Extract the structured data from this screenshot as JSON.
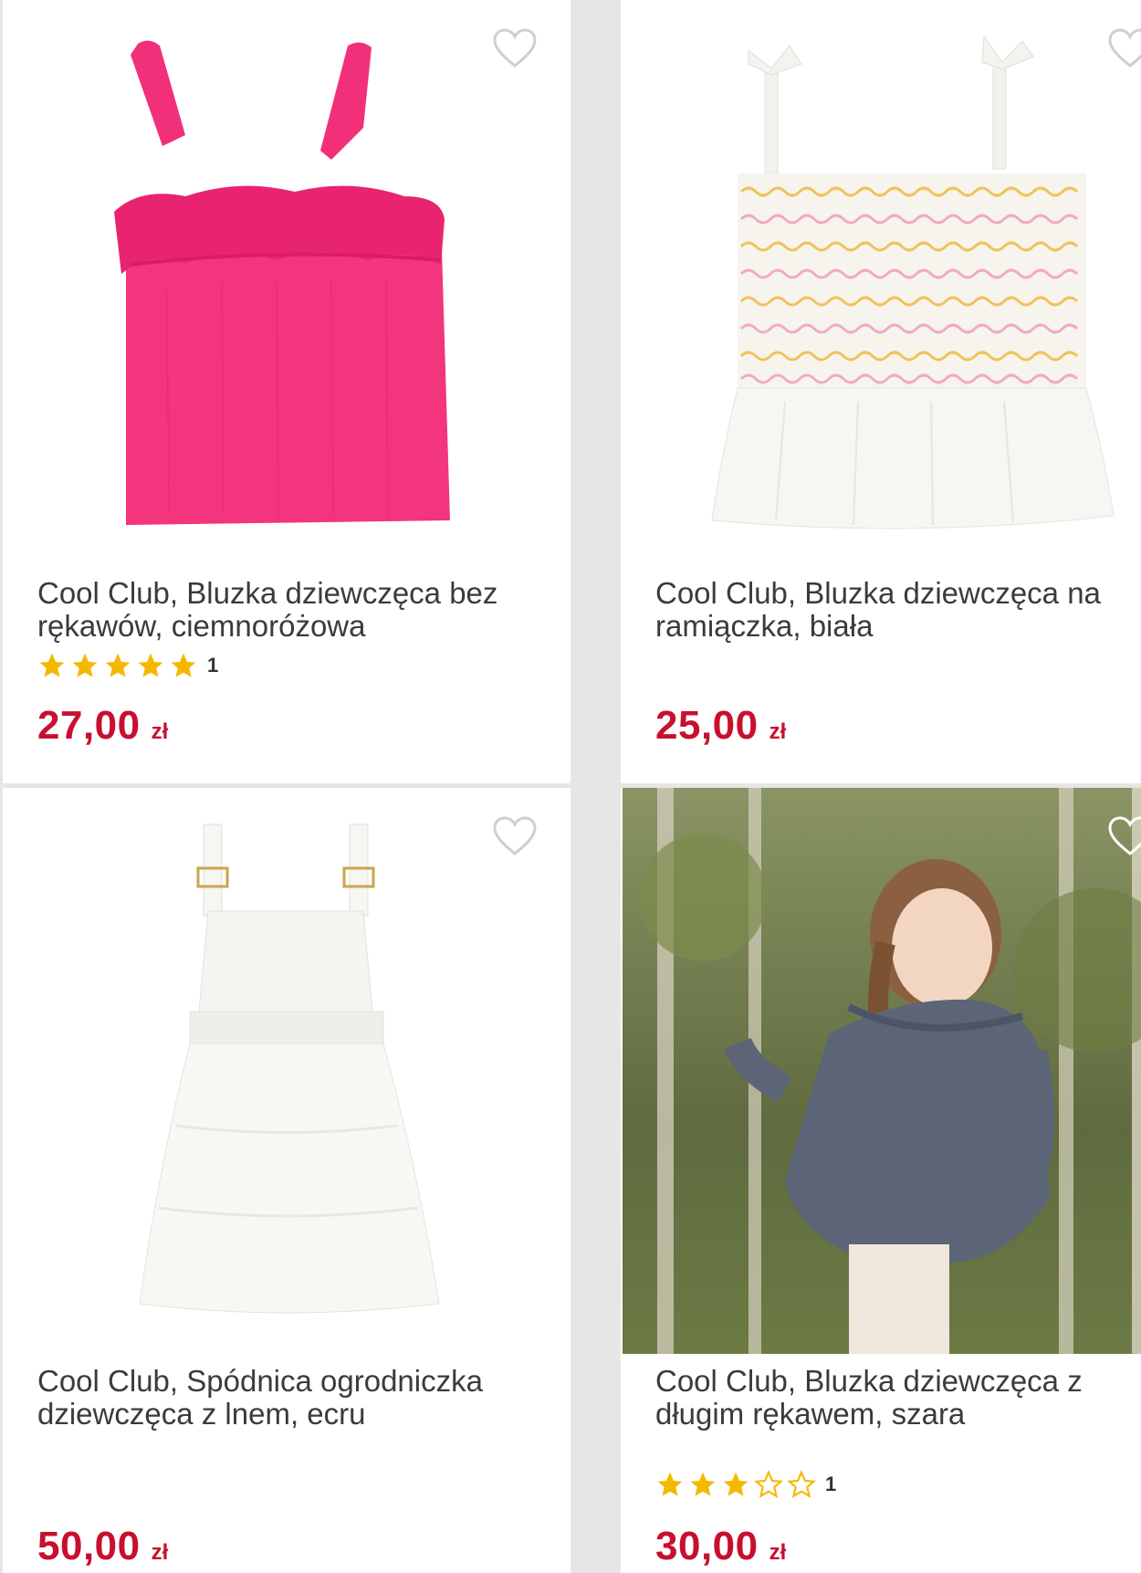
{
  "products": [
    {
      "title": "Cool Club, Bluzka dziewczęca bez rękawów, ciemnoróżowa",
      "rating": 5,
      "rating_count": "1",
      "price": "27,00",
      "currency": "zł",
      "image": "pink-ruffled-top"
    },
    {
      "title": "Cool Club, Bluzka dziewczęca na ramiączka, biała",
      "price": "25,00",
      "currency": "zł",
      "image": "white-smocked-top"
    },
    {
      "title": "Cool Club, Spódnica ogrodniczka dziewczęca z lnem, ecru",
      "price": "50,00",
      "currency": "zł",
      "image": "white-pinafore-dress"
    },
    {
      "title": "Cool Club, Bluzka dziewczęca z długim rękawem, szara",
      "rating": 3,
      "rating_count": "1",
      "price": "30,00",
      "currency": "zł",
      "image": "girl-in-grey-blouse-photo"
    }
  ],
  "colors": {
    "price": "#c8102e",
    "star": "#f5b800",
    "background": "#e6e6e6",
    "card": "#ffffff",
    "title": "#3b3b3b"
  },
  "icons": {
    "favorite": "heart-outline-icon",
    "star_full": "star-filled-icon",
    "star_empty": "star-outline-icon"
  }
}
